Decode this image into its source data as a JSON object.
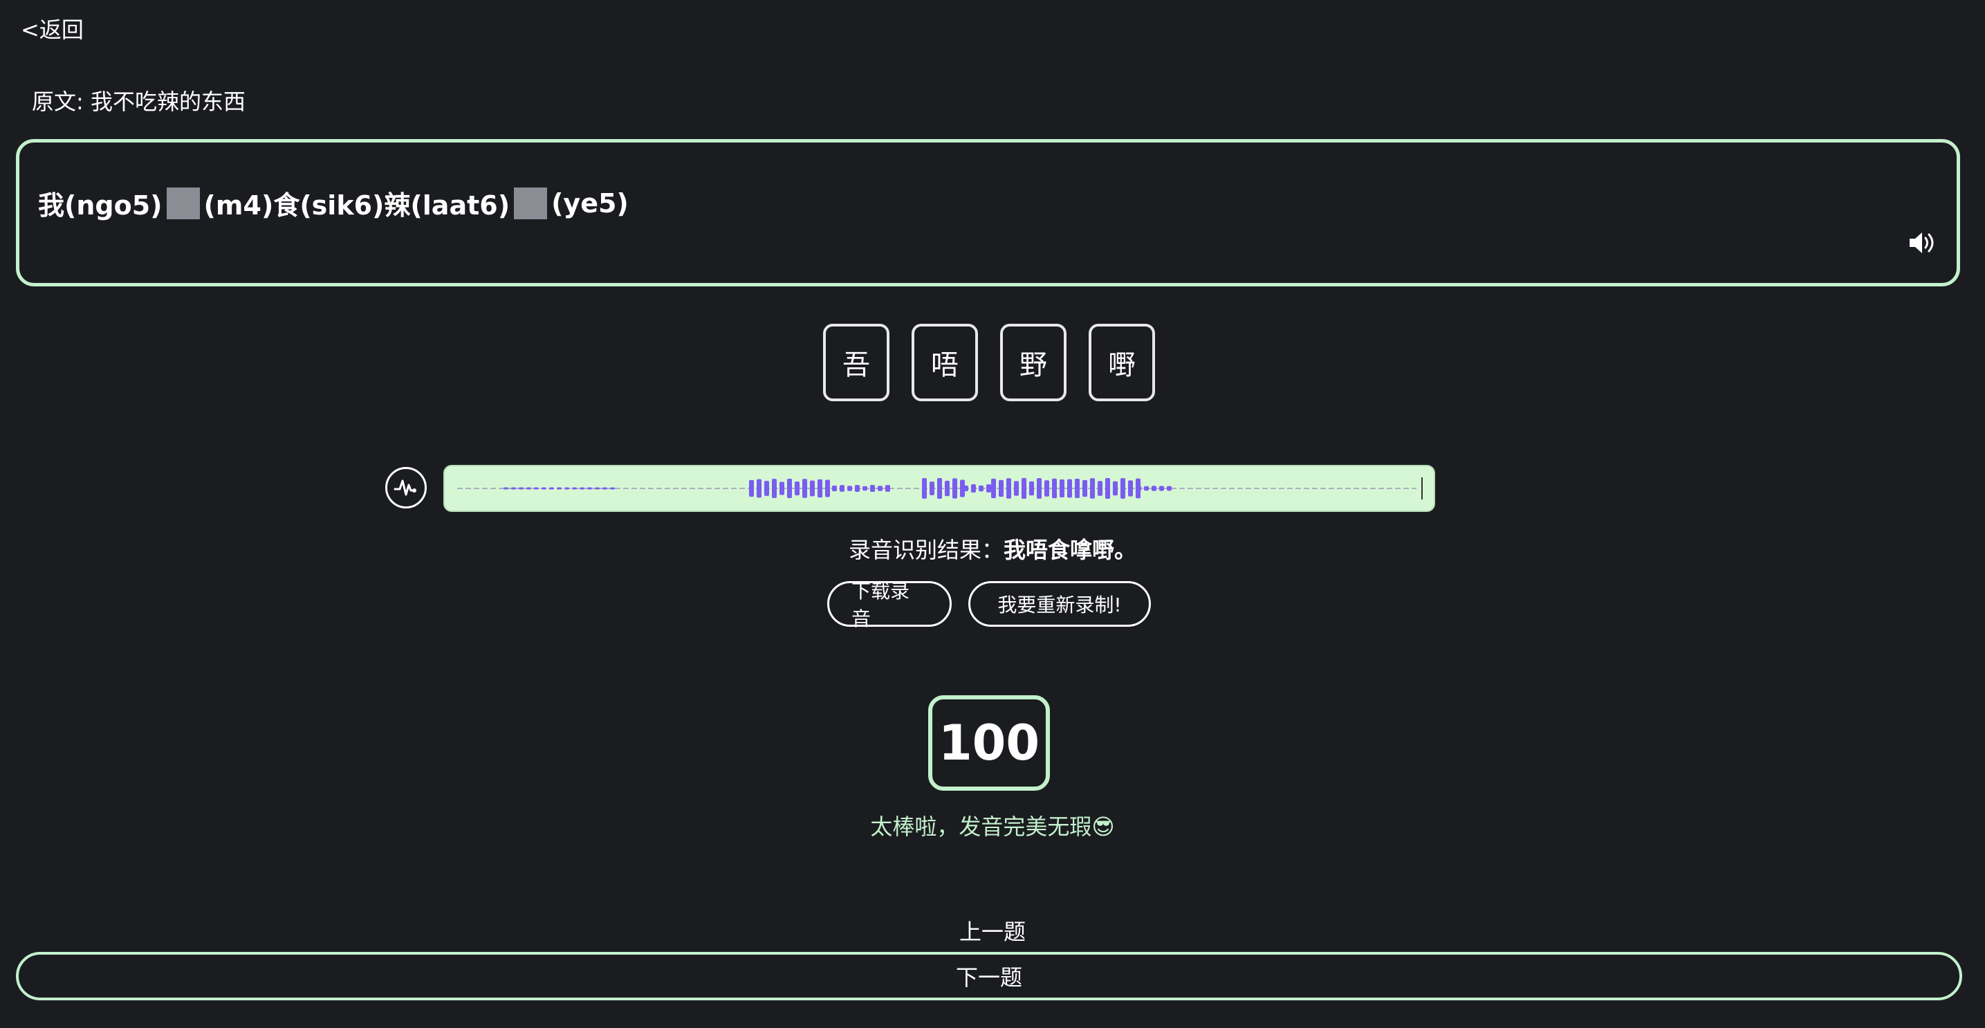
{
  "nav": {
    "back_label": "<返回"
  },
  "original": {
    "text": "原文: 我不吃辣的东西"
  },
  "sentence": {
    "part1": "我(ngo5)",
    "part2": "(m4)食(sik6)辣(laat6)",
    "part3": "(ye5)",
    "blank_color": "#8a8d94",
    "speaker_icon": "speaker-icon"
  },
  "options": [
    "吾",
    "唔",
    "野",
    "嘢"
  ],
  "recording": {
    "wave_icon": "waveform-icon",
    "bar_color": "#d6f7d4",
    "wave_color": "#7a5cf0",
    "result_label": "录音识别结果：",
    "result_value": "我唔食嗱嘢。",
    "download_label": "下载录音",
    "rerecord_label": "我要重新录制!"
  },
  "score": {
    "value": "100",
    "message": "太棒啦，发音完美无瑕😎"
  },
  "navigation": {
    "prev_label": "上一题",
    "next_label": "下一题"
  },
  "colors": {
    "accent": "#c3f0cc",
    "background": "#1b1c20"
  }
}
